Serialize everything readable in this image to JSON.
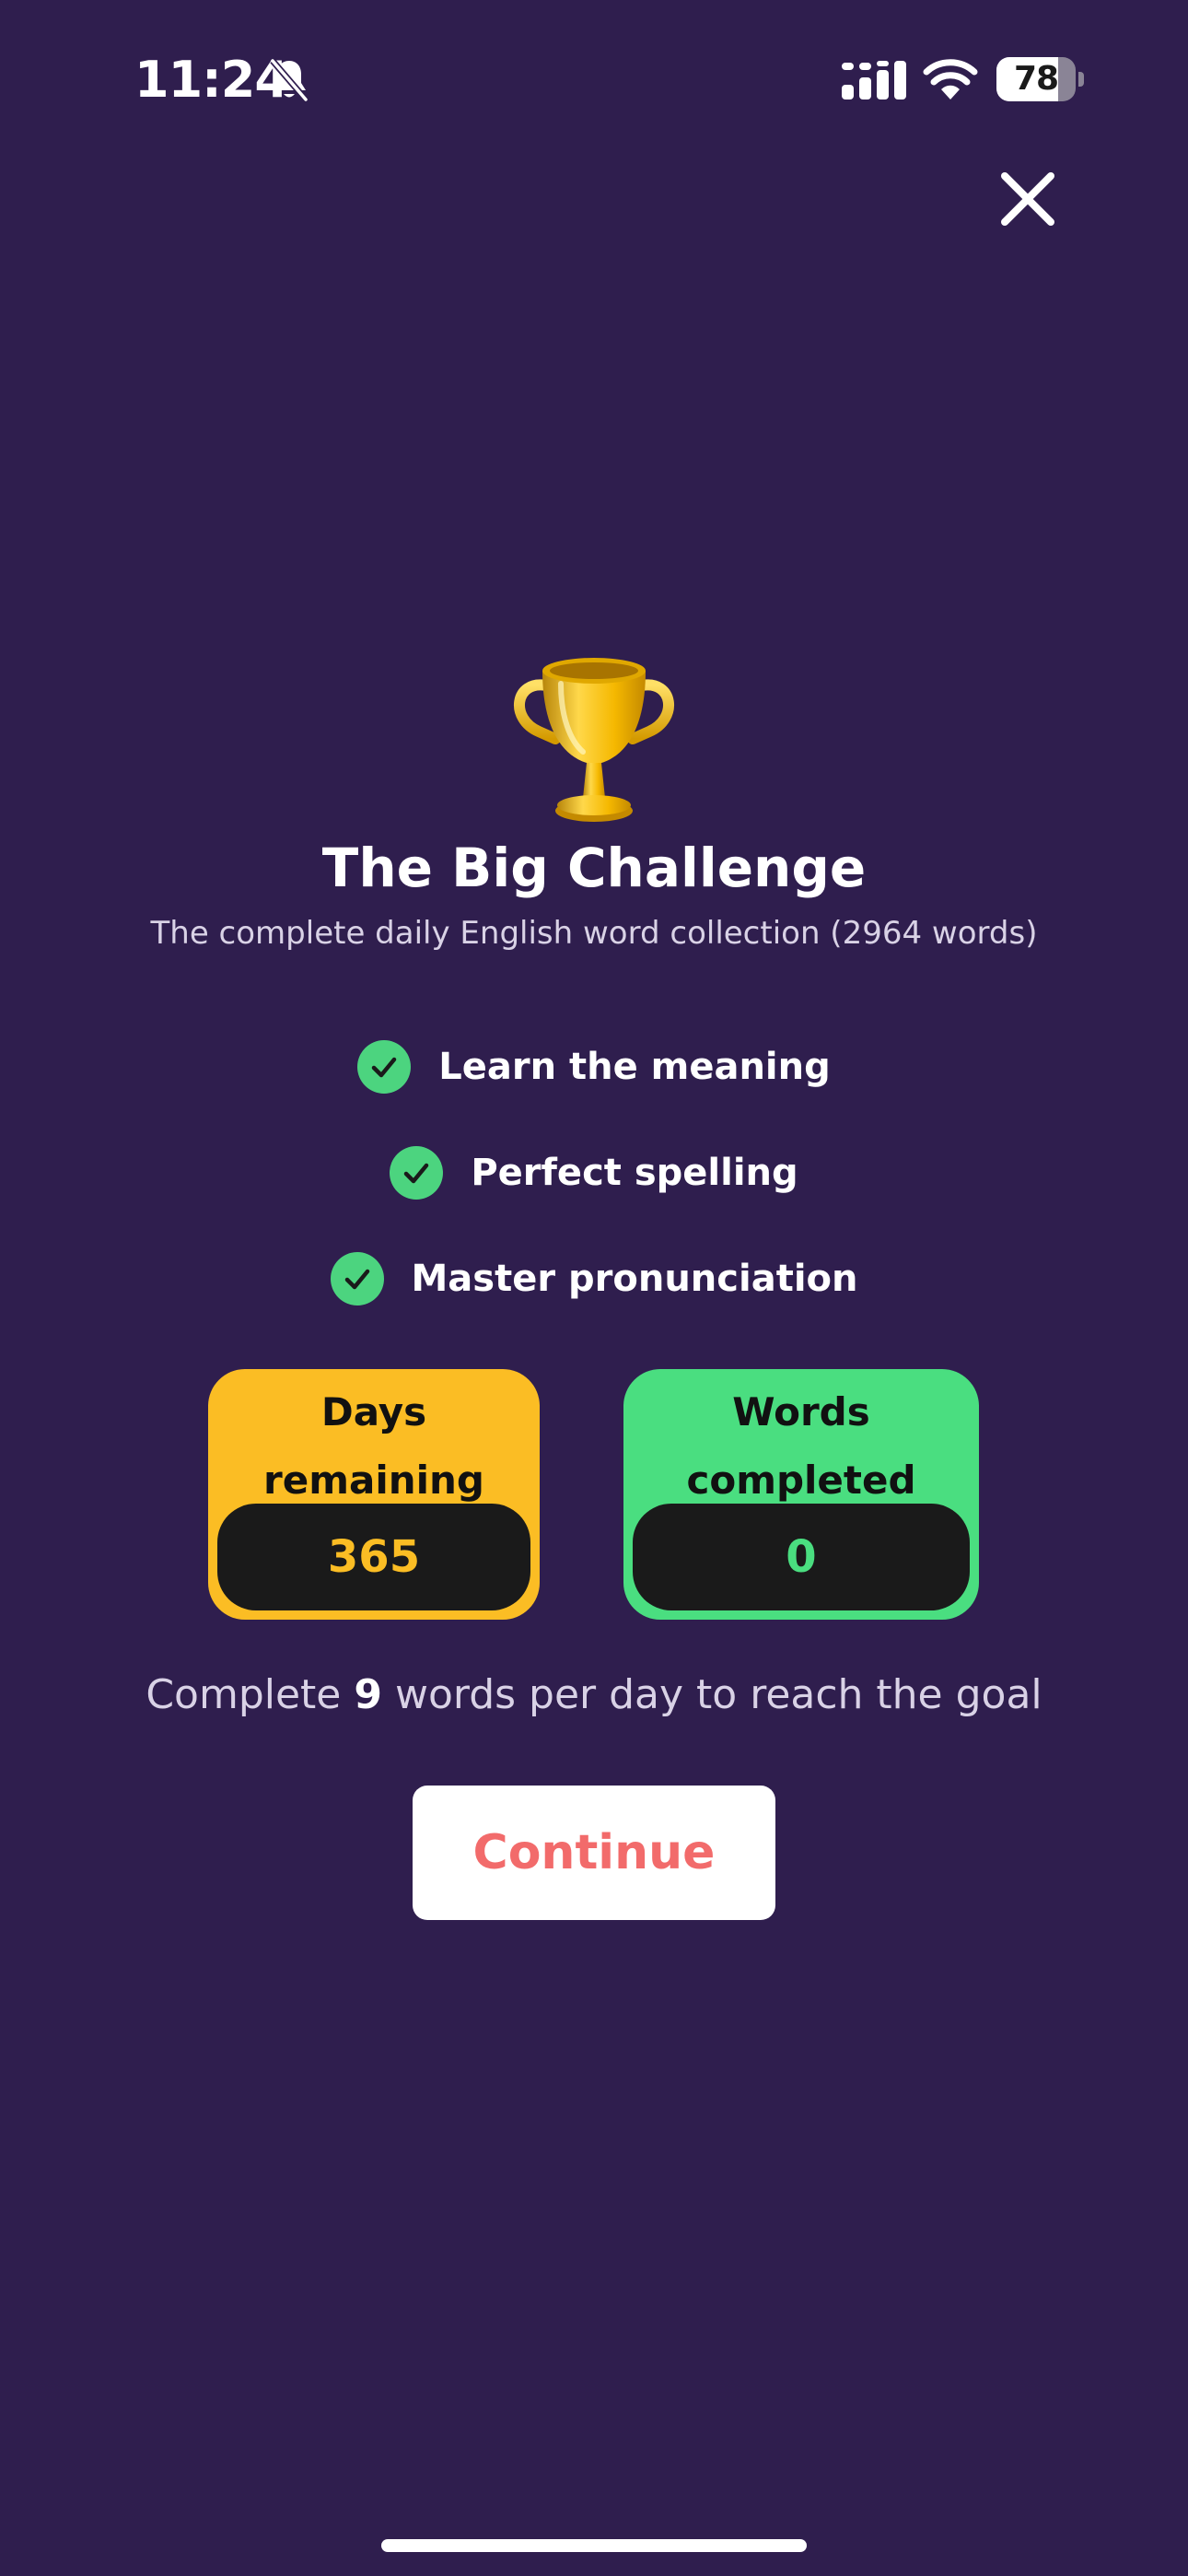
{
  "status_bar": {
    "time": "11:24",
    "battery_level": "78",
    "battery_fraction": 0.78
  },
  "icons": {
    "close": "close-icon",
    "trophy": "trophy-icon",
    "check": "check-icon",
    "bell_muted": "bell-slash-icon"
  },
  "colors": {
    "background": "#2f1e4e",
    "days_accent": "#fbbd24",
    "words_accent": "#4ade80",
    "check": "#4cd47f",
    "continue_text": "#f26b6b"
  },
  "challenge": {
    "title": "The Big Challenge",
    "subtitle": "The complete daily English word collection (2964 words)"
  },
  "features": [
    {
      "label": "Learn the meaning"
    },
    {
      "label": "Perfect spelling"
    },
    {
      "label": "Master pronunciation"
    }
  ],
  "stats": {
    "days": {
      "label": "Days\nremaining",
      "value": "365"
    },
    "words": {
      "label": "Words\ncompleted",
      "value": "0"
    }
  },
  "goal": {
    "prefix": "Complete ",
    "count": "9",
    "suffix": " words per day to reach the goal"
  },
  "continue_label": "Continue"
}
